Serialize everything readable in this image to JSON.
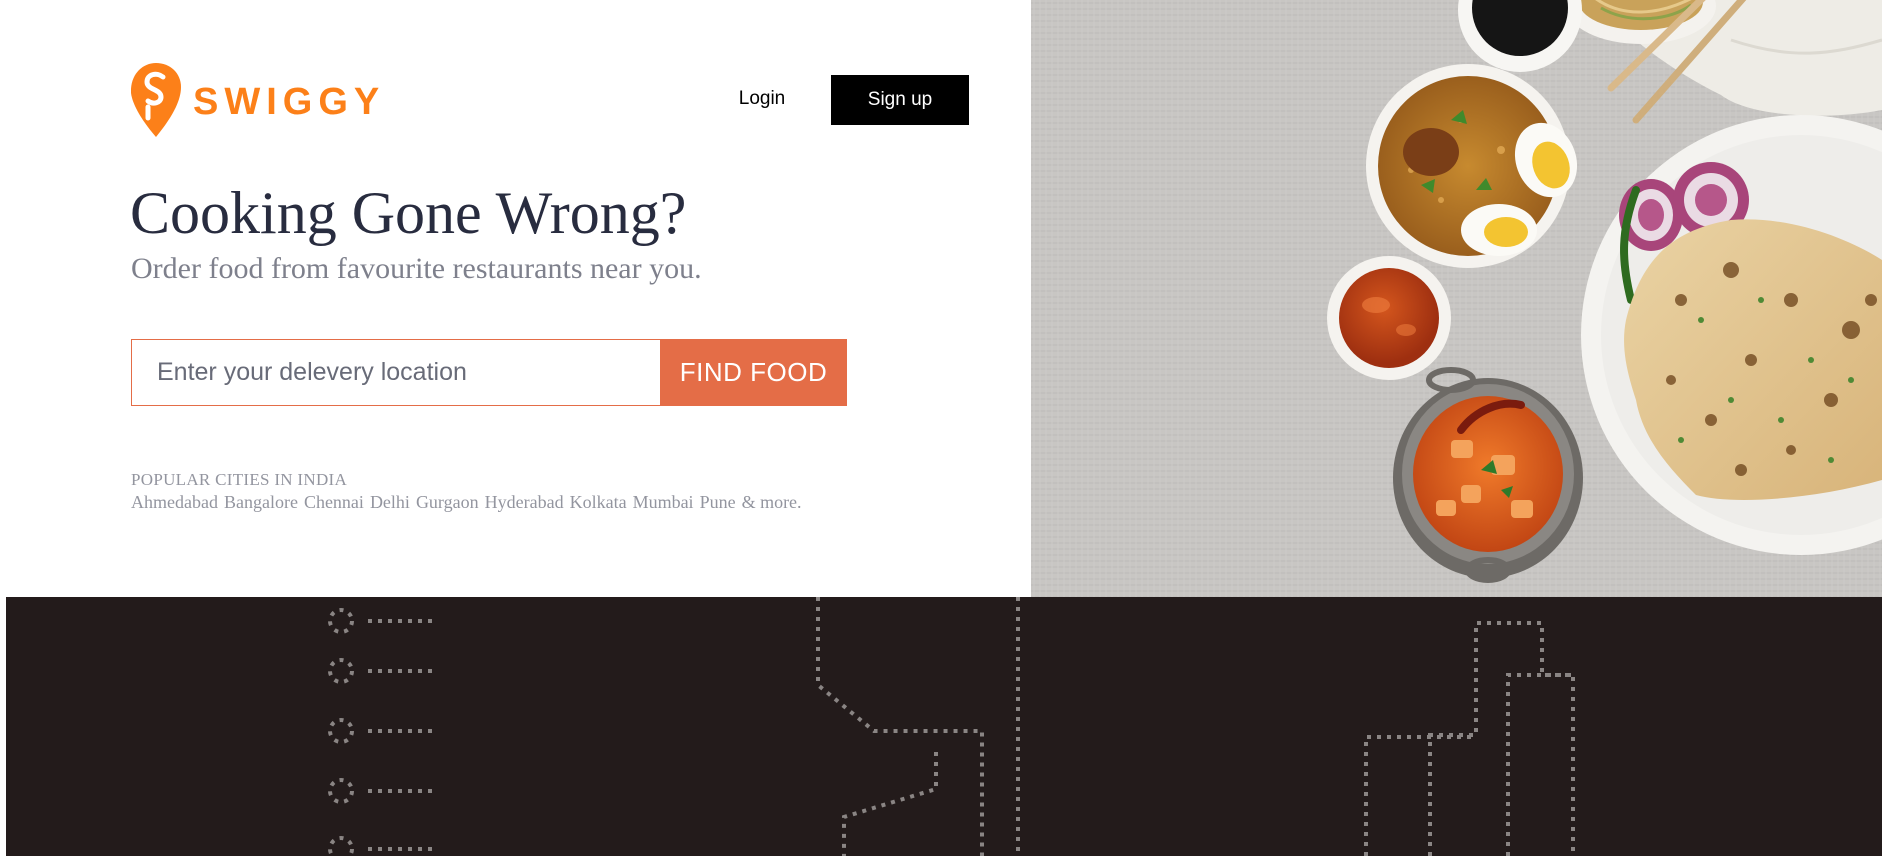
{
  "brand": {
    "name": "SWIGGY",
    "color": "#fc8019",
    "logo_icon": "swiggy-logo-icon"
  },
  "nav": {
    "login": "Login",
    "signup": "Sign up"
  },
  "hero": {
    "title": "Cooking Gone Wrong?",
    "subtitle": "Order food from favourite restaurants near you."
  },
  "search": {
    "placeholder": "Enter your delevery location",
    "value": "",
    "button": "FIND FOOD",
    "accent": "#e46d47"
  },
  "popular": {
    "title": "POPULAR CITIES IN INDIA",
    "cities": [
      "Ahmedabad",
      "Bangalore",
      "Chennai",
      "Delhi",
      "Gurgaon",
      "Hyderabad",
      "Kolkata",
      "Mumbai",
      "Pune"
    ],
    "more": "& more."
  },
  "colors": {
    "footer_bg": "#231b1b",
    "text_dark": "#282c3f",
    "text_muted": "#7e808c"
  }
}
